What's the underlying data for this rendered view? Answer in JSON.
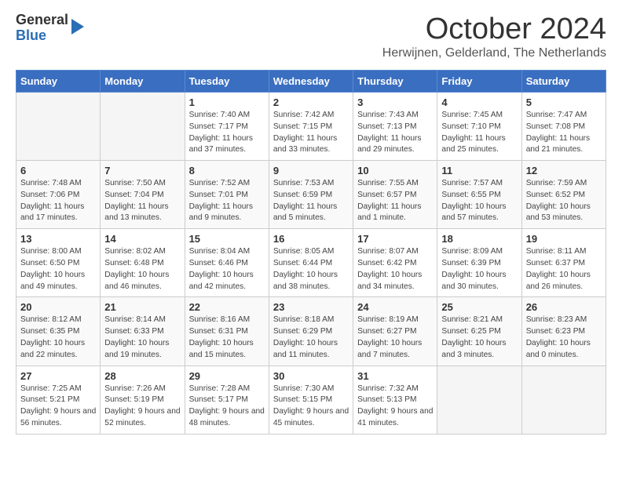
{
  "logo": {
    "general": "General",
    "blue": "Blue"
  },
  "title": "October 2024",
  "location": "Herwijnen, Gelderland, The Netherlands",
  "days_of_week": [
    "Sunday",
    "Monday",
    "Tuesday",
    "Wednesday",
    "Thursday",
    "Friday",
    "Saturday"
  ],
  "weeks": [
    [
      {
        "day": "",
        "empty": true
      },
      {
        "day": "",
        "empty": true
      },
      {
        "day": "1",
        "sunrise": "Sunrise: 7:40 AM",
        "sunset": "Sunset: 7:17 PM",
        "daylight": "Daylight: 11 hours and 37 minutes."
      },
      {
        "day": "2",
        "sunrise": "Sunrise: 7:42 AM",
        "sunset": "Sunset: 7:15 PM",
        "daylight": "Daylight: 11 hours and 33 minutes."
      },
      {
        "day": "3",
        "sunrise": "Sunrise: 7:43 AM",
        "sunset": "Sunset: 7:13 PM",
        "daylight": "Daylight: 11 hours and 29 minutes."
      },
      {
        "day": "4",
        "sunrise": "Sunrise: 7:45 AM",
        "sunset": "Sunset: 7:10 PM",
        "daylight": "Daylight: 11 hours and 25 minutes."
      },
      {
        "day": "5",
        "sunrise": "Sunrise: 7:47 AM",
        "sunset": "Sunset: 7:08 PM",
        "daylight": "Daylight: 11 hours and 21 minutes."
      }
    ],
    [
      {
        "day": "6",
        "sunrise": "Sunrise: 7:48 AM",
        "sunset": "Sunset: 7:06 PM",
        "daylight": "Daylight: 11 hours and 17 minutes."
      },
      {
        "day": "7",
        "sunrise": "Sunrise: 7:50 AM",
        "sunset": "Sunset: 7:04 PM",
        "daylight": "Daylight: 11 hours and 13 minutes."
      },
      {
        "day": "8",
        "sunrise": "Sunrise: 7:52 AM",
        "sunset": "Sunset: 7:01 PM",
        "daylight": "Daylight: 11 hours and 9 minutes."
      },
      {
        "day": "9",
        "sunrise": "Sunrise: 7:53 AM",
        "sunset": "Sunset: 6:59 PM",
        "daylight": "Daylight: 11 hours and 5 minutes."
      },
      {
        "day": "10",
        "sunrise": "Sunrise: 7:55 AM",
        "sunset": "Sunset: 6:57 PM",
        "daylight": "Daylight: 11 hours and 1 minute."
      },
      {
        "day": "11",
        "sunrise": "Sunrise: 7:57 AM",
        "sunset": "Sunset: 6:55 PM",
        "daylight": "Daylight: 10 hours and 57 minutes."
      },
      {
        "day": "12",
        "sunrise": "Sunrise: 7:59 AM",
        "sunset": "Sunset: 6:52 PM",
        "daylight": "Daylight: 10 hours and 53 minutes."
      }
    ],
    [
      {
        "day": "13",
        "sunrise": "Sunrise: 8:00 AM",
        "sunset": "Sunset: 6:50 PM",
        "daylight": "Daylight: 10 hours and 49 minutes."
      },
      {
        "day": "14",
        "sunrise": "Sunrise: 8:02 AM",
        "sunset": "Sunset: 6:48 PM",
        "daylight": "Daylight: 10 hours and 46 minutes."
      },
      {
        "day": "15",
        "sunrise": "Sunrise: 8:04 AM",
        "sunset": "Sunset: 6:46 PM",
        "daylight": "Daylight: 10 hours and 42 minutes."
      },
      {
        "day": "16",
        "sunrise": "Sunrise: 8:05 AM",
        "sunset": "Sunset: 6:44 PM",
        "daylight": "Daylight: 10 hours and 38 minutes."
      },
      {
        "day": "17",
        "sunrise": "Sunrise: 8:07 AM",
        "sunset": "Sunset: 6:42 PM",
        "daylight": "Daylight: 10 hours and 34 minutes."
      },
      {
        "day": "18",
        "sunrise": "Sunrise: 8:09 AM",
        "sunset": "Sunset: 6:39 PM",
        "daylight": "Daylight: 10 hours and 30 minutes."
      },
      {
        "day": "19",
        "sunrise": "Sunrise: 8:11 AM",
        "sunset": "Sunset: 6:37 PM",
        "daylight": "Daylight: 10 hours and 26 minutes."
      }
    ],
    [
      {
        "day": "20",
        "sunrise": "Sunrise: 8:12 AM",
        "sunset": "Sunset: 6:35 PM",
        "daylight": "Daylight: 10 hours and 22 minutes."
      },
      {
        "day": "21",
        "sunrise": "Sunrise: 8:14 AM",
        "sunset": "Sunset: 6:33 PM",
        "daylight": "Daylight: 10 hours and 19 minutes."
      },
      {
        "day": "22",
        "sunrise": "Sunrise: 8:16 AM",
        "sunset": "Sunset: 6:31 PM",
        "daylight": "Daylight: 10 hours and 15 minutes."
      },
      {
        "day": "23",
        "sunrise": "Sunrise: 8:18 AM",
        "sunset": "Sunset: 6:29 PM",
        "daylight": "Daylight: 10 hours and 11 minutes."
      },
      {
        "day": "24",
        "sunrise": "Sunrise: 8:19 AM",
        "sunset": "Sunset: 6:27 PM",
        "daylight": "Daylight: 10 hours and 7 minutes."
      },
      {
        "day": "25",
        "sunrise": "Sunrise: 8:21 AM",
        "sunset": "Sunset: 6:25 PM",
        "daylight": "Daylight: 10 hours and 3 minutes."
      },
      {
        "day": "26",
        "sunrise": "Sunrise: 8:23 AM",
        "sunset": "Sunset: 6:23 PM",
        "daylight": "Daylight: 10 hours and 0 minutes."
      }
    ],
    [
      {
        "day": "27",
        "sunrise": "Sunrise: 7:25 AM",
        "sunset": "Sunset: 5:21 PM",
        "daylight": "Daylight: 9 hours and 56 minutes."
      },
      {
        "day": "28",
        "sunrise": "Sunrise: 7:26 AM",
        "sunset": "Sunset: 5:19 PM",
        "daylight": "Daylight: 9 hours and 52 minutes."
      },
      {
        "day": "29",
        "sunrise": "Sunrise: 7:28 AM",
        "sunset": "Sunset: 5:17 PM",
        "daylight": "Daylight: 9 hours and 48 minutes."
      },
      {
        "day": "30",
        "sunrise": "Sunrise: 7:30 AM",
        "sunset": "Sunset: 5:15 PM",
        "daylight": "Daylight: 9 hours and 45 minutes."
      },
      {
        "day": "31",
        "sunrise": "Sunrise: 7:32 AM",
        "sunset": "Sunset: 5:13 PM",
        "daylight": "Daylight: 9 hours and 41 minutes."
      },
      {
        "day": "",
        "empty": true
      },
      {
        "day": "",
        "empty": true
      }
    ]
  ]
}
